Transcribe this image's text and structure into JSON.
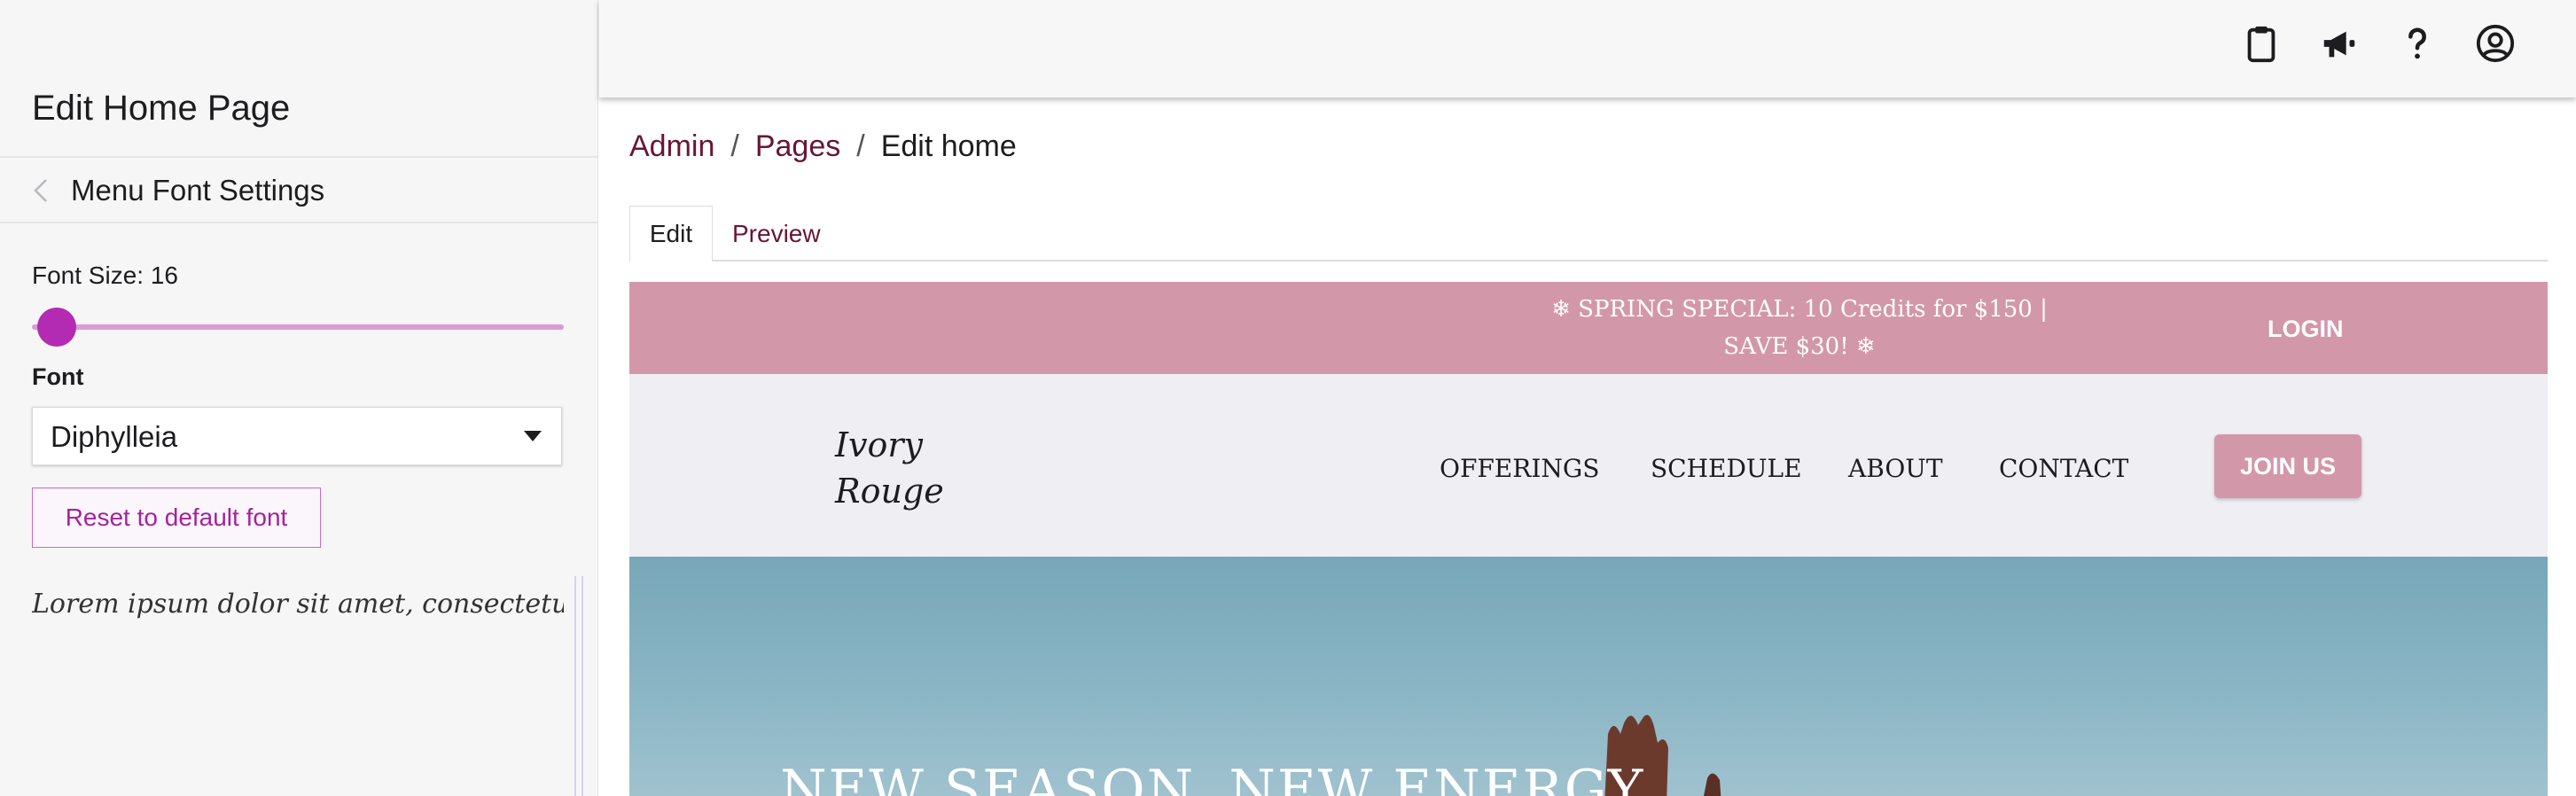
{
  "left_panel": {
    "title": "Edit Home Page",
    "back_label": "Menu Font Settings",
    "font_size_label": "Font Size: 16",
    "font_size_value": 16,
    "font_label": "Font",
    "font_selected": "Diphylleia",
    "reset_button": "Reset to default font",
    "preview_text": "Lorem ipsum dolor sit amet, consectetur adipiscing elit"
  },
  "topbar": {
    "icons": [
      "clipboard-icon",
      "megaphone-icon",
      "help-icon",
      "account-icon"
    ]
  },
  "breadcrumb": {
    "items": [
      "Admin",
      "Pages",
      "Edit home"
    ],
    "separator": "/"
  },
  "tabs": [
    "Edit",
    "Preview"
  ],
  "site_preview": {
    "banner_line1": "❄ SPRING SPECIAL: 10 Credits for $150 |",
    "banner_line2": "SAVE $30! ❄",
    "login": "LOGIN",
    "logo_line1": "Ivory",
    "logo_line2": "Rouge",
    "nav": [
      "OFFERINGS",
      "SCHEDULE",
      "ABOUT",
      "CONTACT"
    ],
    "join_button": "JOIN US",
    "hero_title": "NEW SEASON. NEW ENERGY."
  },
  "colors": {
    "accent": "#b22bb2",
    "brand": "#d397aa",
    "link": "#6a1535"
  }
}
